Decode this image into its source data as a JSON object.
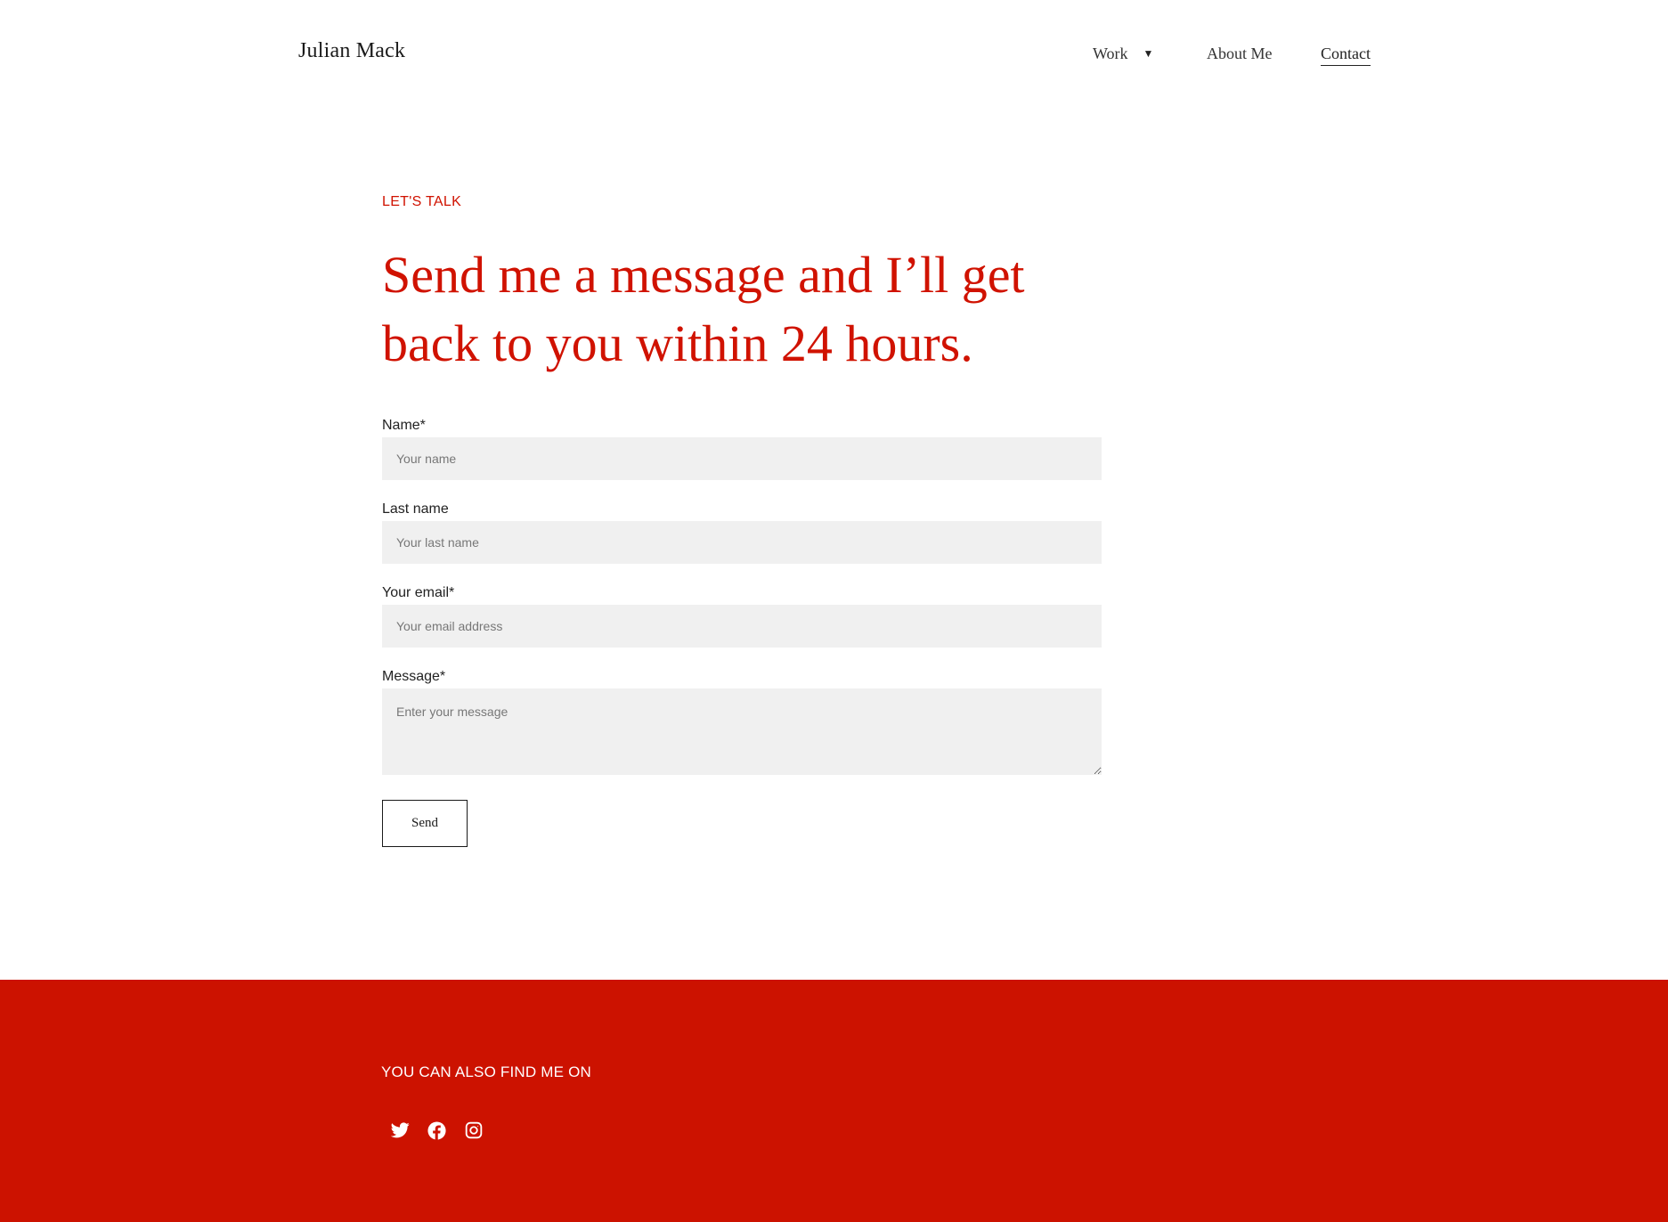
{
  "header": {
    "brand": "Julian Mack",
    "nav": {
      "work_label": "Work",
      "about_label": "About Me",
      "contact_label": "Contact",
      "active": "Contact"
    }
  },
  "main": {
    "eyebrow": "LET'S TALK",
    "headline": "Send me a message and I’ll get back to you within 24 hours.",
    "form": {
      "name_label": "Name*",
      "name_placeholder": "Your name",
      "last_name_label": "Last name",
      "last_name_placeholder": "Your last name",
      "email_label": "Your email*",
      "email_placeholder": "Your email address",
      "message_label": "Message*",
      "message_placeholder": "Enter your message",
      "send_label": "Send"
    }
  },
  "footer": {
    "title": "YOU CAN ALSO FIND ME ON",
    "social": [
      "twitter-icon",
      "facebook-icon",
      "instagram-icon"
    ]
  },
  "colors": {
    "accent": "#d01200",
    "footer_bg": "#cc1200",
    "field_bg": "#f0f0f0"
  }
}
